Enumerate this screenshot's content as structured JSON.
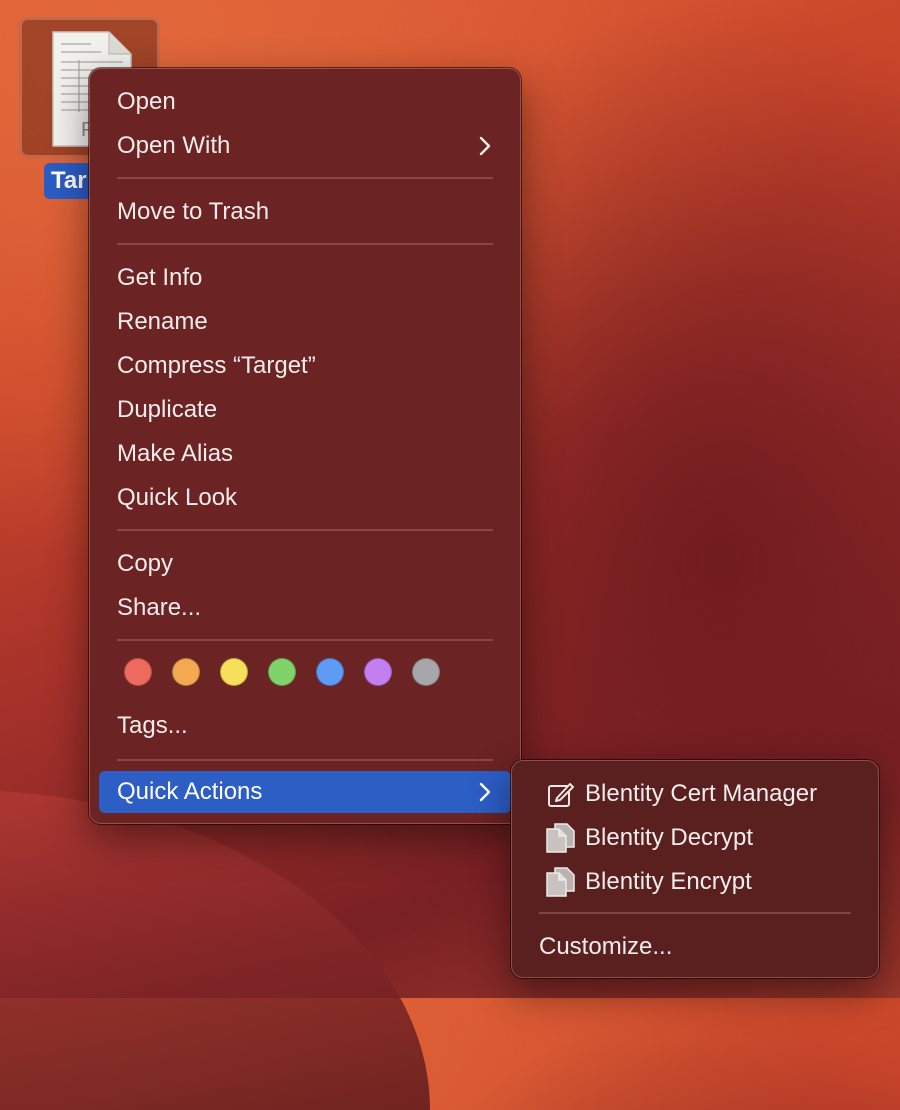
{
  "desktop": {
    "file": {
      "label": "Tar",
      "doc_text": "PDF"
    }
  },
  "context_menu": {
    "groups": [
      {
        "items": [
          {
            "label": "Open",
            "submenu": false
          },
          {
            "label": "Open With",
            "submenu": true
          }
        ]
      },
      {
        "items": [
          {
            "label": "Move to Trash",
            "submenu": false
          }
        ]
      },
      {
        "items": [
          {
            "label": "Get Info",
            "submenu": false
          },
          {
            "label": "Rename",
            "submenu": false
          },
          {
            "label": "Compress “Target”",
            "submenu": false
          },
          {
            "label": "Duplicate",
            "submenu": false
          },
          {
            "label": "Make Alias",
            "submenu": false
          },
          {
            "label": "Quick Look",
            "submenu": false
          }
        ]
      },
      {
        "items": [
          {
            "label": "Copy",
            "submenu": false
          },
          {
            "label": "Share...",
            "submenu": false
          }
        ]
      }
    ],
    "tag_colors": [
      {
        "name": "red",
        "color": "#ec6a5e"
      },
      {
        "name": "orange",
        "color": "#f3a951"
      },
      {
        "name": "yellow",
        "color": "#f7df5b"
      },
      {
        "name": "green",
        "color": "#7fd36a"
      },
      {
        "name": "blue",
        "color": "#5e9bf5"
      },
      {
        "name": "purple",
        "color": "#c37ef0"
      },
      {
        "name": "gray",
        "color": "#a7a7ab"
      }
    ],
    "tags_label": "Tags...",
    "quick_actions_label": "Quick Actions"
  },
  "quick_actions_submenu": {
    "items": [
      {
        "label": "Blentity Cert Manager",
        "icon": "edit-icon"
      },
      {
        "label": "Blentity Decrypt",
        "icon": "document-icon"
      },
      {
        "label": "Blentity Encrypt",
        "icon": "document-icon"
      }
    ],
    "customize_label": "Customize..."
  },
  "colors": {
    "highlight": "#2d5ec6",
    "menu_background": "#6b2323"
  }
}
